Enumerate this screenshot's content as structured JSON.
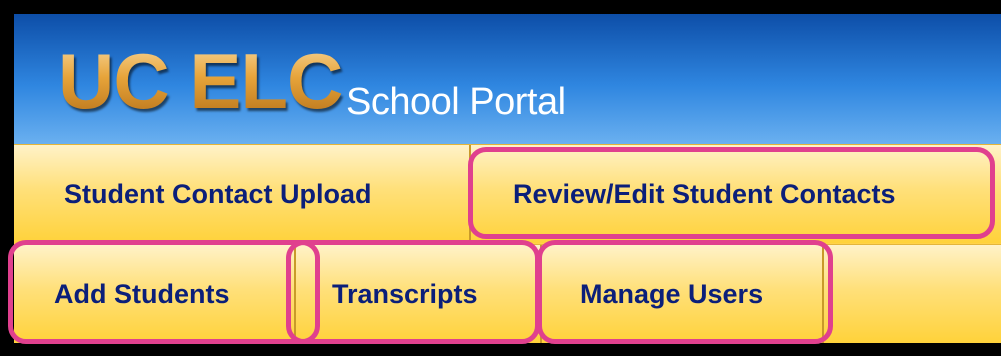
{
  "header": {
    "logo_text": "UC ELC",
    "subtitle": "School Portal"
  },
  "nav": {
    "row1": [
      {
        "label": "Student Contact Upload",
        "highlighted": false
      },
      {
        "label": "Review/Edit Student Contacts",
        "highlighted": true
      }
    ],
    "row2": [
      {
        "label": "Add Students",
        "highlighted": true
      },
      {
        "label": "Transcripts",
        "highlighted": true
      },
      {
        "label": "Manage Users",
        "highlighted": true
      }
    ]
  },
  "colors": {
    "header_blue": "#2f86e0",
    "logo_gold": "#e6a83a",
    "nav_yellow": "#ffd24a",
    "tab_text": "#0b1f7a",
    "highlight_pink": "#e0408e"
  }
}
